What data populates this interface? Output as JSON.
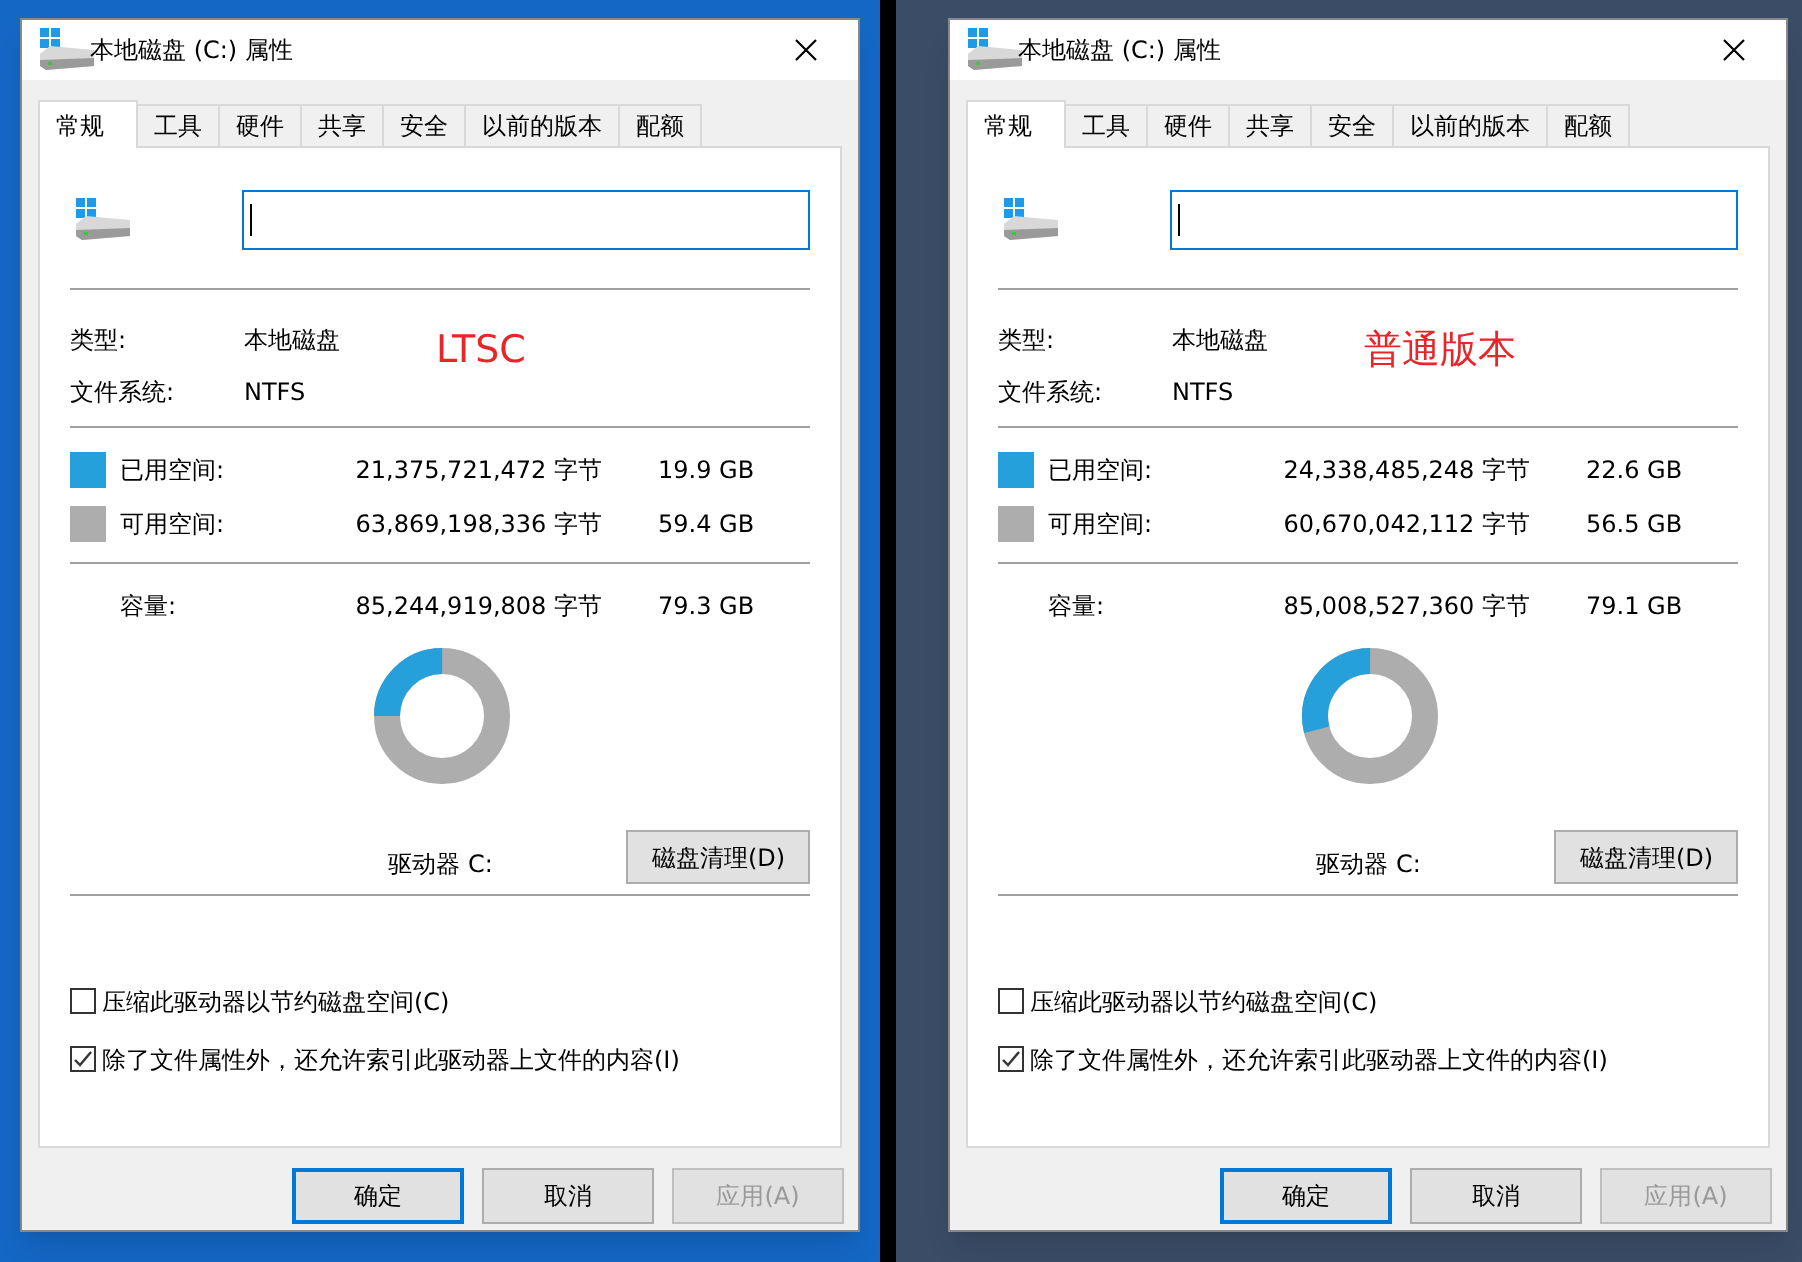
{
  "dialogs": [
    {
      "title": "本地磁盘 (C:) 属性",
      "tabs": [
        {
          "label": "常规",
          "selected": true
        },
        {
          "label": "工具",
          "selected": false
        },
        {
          "label": "硬件",
          "selected": false
        },
        {
          "label": "共享",
          "selected": false
        },
        {
          "label": "安全",
          "selected": false
        },
        {
          "label": "以前的版本",
          "selected": false
        },
        {
          "label": "配额",
          "selected": false
        }
      ],
      "info": [
        {
          "label": "类型:",
          "value": "本地磁盘"
        },
        {
          "label": "文件系统:",
          "value": "NTFS"
        }
      ],
      "annotation": "LTSC",
      "space": [
        {
          "label": "已用空间:",
          "bytes": "21,375,721,472 字节",
          "size": "19.9 GB",
          "color": "#26a0da"
        },
        {
          "label": "可用空间:",
          "bytes": "63,869,198,336 字节",
          "size": "59.4 GB",
          "color": "#adadad"
        }
      ],
      "capacity": {
        "label": "容量:",
        "bytes": "85,244,919,808 字节",
        "size": "79.3 GB"
      },
      "usage": {
        "level": 0.25
      },
      "drive_label": "驱动器 C:",
      "cleanup_button": "磁盘清理(D)",
      "options": [
        {
          "label": "压缩此驱动器以节约磁盘空间(C)",
          "checked": false
        },
        {
          "label": "除了文件属性外，还允许索引此驱动器上文件的内容(I)",
          "checked": true
        }
      ],
      "buttons": [
        {
          "label": "确定",
          "kind": "default"
        },
        {
          "label": "取消",
          "kind": "normal"
        },
        {
          "label": "应用(A)",
          "kind": "disabled"
        }
      ]
    },
    {
      "title": "本地磁盘 (C:) 属性",
      "tabs": [
        {
          "label": "常规",
          "selected": true
        },
        {
          "label": "工具",
          "selected": false
        },
        {
          "label": "硬件",
          "selected": false
        },
        {
          "label": "共享",
          "selected": false
        },
        {
          "label": "安全",
          "selected": false
        },
        {
          "label": "以前的版本",
          "selected": false
        },
        {
          "label": "配额",
          "selected": false
        }
      ],
      "info": [
        {
          "label": "类型:",
          "value": "本地磁盘"
        },
        {
          "label": "文件系统:",
          "value": "NTFS"
        }
      ],
      "annotation": "普通版本",
      "space": [
        {
          "label": "已用空间:",
          "bytes": "24,338,485,248 字节",
          "size": "22.6 GB",
          "color": "#26a0da"
        },
        {
          "label": "可用空间:",
          "bytes": "60,670,042,112 字节",
          "size": "56.5 GB",
          "color": "#adadad"
        }
      ],
      "capacity": {
        "label": "容量:",
        "bytes": "85,008,527,360 字节",
        "size": "79.1 GB"
      },
      "usage": {
        "level": 0.29
      },
      "drive_label": "驱动器 C:",
      "cleanup_button": "磁盘清理(D)",
      "options": [
        {
          "label": "压缩此驱动器以节约磁盘空间(C)",
          "checked": false
        },
        {
          "label": "除了文件属性外，还允许索引此驱动器上文件的内容(I)",
          "checked": true
        }
      ],
      "buttons": [
        {
          "label": "确定",
          "kind": "default"
        },
        {
          "label": "取消",
          "kind": "normal"
        },
        {
          "label": "应用(A)",
          "kind": "disabled"
        }
      ]
    }
  ]
}
